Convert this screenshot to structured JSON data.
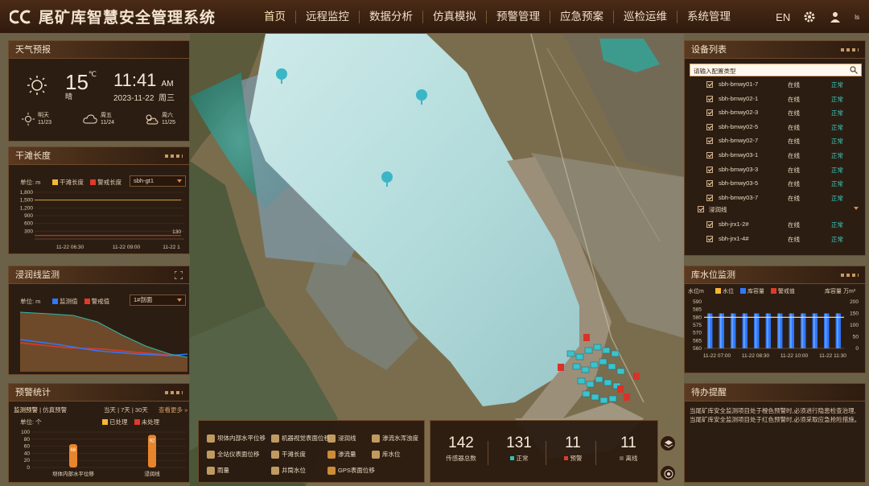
{
  "app": {
    "title": "尾矿库智慧安全管理系统"
  },
  "nav": {
    "items": [
      "首页",
      "远程监控",
      "数据分析",
      "仿真模拟",
      "预警管理",
      "应急预案",
      "巡检运维",
      "系统管理"
    ],
    "lang": "EN",
    "user_badge": "ls"
  },
  "weather": {
    "title": "天气预报",
    "temp": "15",
    "unit": "℃",
    "condition": "晴",
    "time": "11:41",
    "ampm": "AM",
    "date": "2023-11-22",
    "weekday": "周三",
    "forecast": [
      {
        "day": "明天",
        "date": "11/23",
        "icon": "sun-icon"
      },
      {
        "day": "周五",
        "date": "11/24",
        "icon": "cloud-icon"
      },
      {
        "day": "周六",
        "date": "11/25",
        "icon": "cloud-sun-icon"
      }
    ]
  },
  "beach": {
    "title": "干滩长度",
    "unit": "单位: m",
    "legend": [
      "干滩长度",
      "警戒长度"
    ],
    "select": "sbh-gt1",
    "ytick": [
      "1,800",
      "1,500",
      "1,200",
      "900",
      "600",
      "300"
    ],
    "xtick": [
      "11-22 06:30",
      "11-22 09:00",
      "11-22 1"
    ],
    "callout": "130",
    "chart_data": {
      "type": "line",
      "x": [
        "11-22 06:30",
        "11-22 09:00",
        "11-22 1"
      ],
      "series": [
        {
          "name": "干滩长度",
          "values": [
            130,
            130,
            130
          ]
        },
        {
          "name": "警戒长度",
          "values": [
            1500,
            1500,
            1500
          ]
        }
      ],
      "ylim": [
        0,
        1800
      ]
    }
  },
  "phreatic": {
    "title": "浸润线监测",
    "unit": "单位: m",
    "legend": [
      "监测值",
      "警戒值"
    ],
    "select": "1#剖面"
  },
  "alarm": {
    "title": "预警统计",
    "tabs": [
      "监测预警",
      "仿真预警"
    ],
    "range": [
      "当天",
      "7天",
      "30天"
    ],
    "more": "查看更多 »",
    "unit": "单位: 个",
    "legend": [
      "已处理",
      "未处理"
    ],
    "ytick": [
      "100",
      "80",
      "60",
      "40",
      "20",
      "0"
    ],
    "chart_data": {
      "type": "bar",
      "categories": [
        "坝体内部水平位移",
        "浸润线"
      ],
      "series": [
        {
          "name": "已处理",
          "values": [
            66,
            92
          ]
        }
      ],
      "ylim": [
        0,
        100
      ]
    }
  },
  "devices": {
    "title": "设备列表",
    "search_placeholder": "请输入配置类型",
    "group2": "浸润线",
    "rows": [
      {
        "name": "sbh-bmwy01-7",
        "status": "在线",
        "health": "正常"
      },
      {
        "name": "sbh-bmwy02-1",
        "status": "在线",
        "health": "正常"
      },
      {
        "name": "sbh-bmwy02-3",
        "status": "在线",
        "health": "正常"
      },
      {
        "name": "sbh-bmwy02-5",
        "status": "在线",
        "health": "正常"
      },
      {
        "name": "sbh-bmwy02-7",
        "status": "在线",
        "health": "正常"
      },
      {
        "name": "sbh-bmwy03-1",
        "status": "在线",
        "health": "正常"
      },
      {
        "name": "sbh-bmwy03-3",
        "status": "在线",
        "health": "正常"
      },
      {
        "name": "sbh-bmwy03-5",
        "status": "在线",
        "health": "正常"
      },
      {
        "name": "sbh-bmwy03-7",
        "status": "在线",
        "health": "正常"
      }
    ],
    "rows2": [
      {
        "name": "sbh-jrx1-2#",
        "status": "在线",
        "health": "正常"
      },
      {
        "name": "sbh-jrx1-4#",
        "status": "在线",
        "health": "正常"
      }
    ]
  },
  "water": {
    "title": "库水位监测",
    "left_unit": "水位m",
    "right_unit": "库容量 万m³",
    "legend": [
      "水位",
      "库容量",
      "警戒值"
    ],
    "yleft": [
      "590",
      "585",
      "580",
      "575",
      "570",
      "565",
      "560"
    ],
    "yright": [
      "200",
      "150",
      "100",
      "50",
      "0"
    ],
    "xtick": [
      "11-22 07:00",
      "11-22 08:30",
      "11-22 10:00",
      "11-22 11:30"
    ],
    "chart_data": {
      "type": "bar",
      "x": [
        "11-22 07:00",
        "11-22 08:30",
        "11-22 10:00",
        "11-22 11:30"
      ],
      "series": [
        {
          "name": "库容量",
          "values": [
            150,
            150,
            150,
            150,
            150,
            150,
            150,
            150,
            150,
            150,
            150,
            150
          ]
        },
        {
          "name": "警戒值",
          "values": [
            580,
            580,
            580,
            580,
            580,
            580,
            580,
            580,
            580,
            580,
            580,
            580
          ]
        }
      ],
      "ylim": [
        560,
        590
      ]
    }
  },
  "todo": {
    "title": "待办提醒",
    "text": "当尾矿库安全监测项目处于橙色预警时,必须进行隐患检查治理,当尾矿库安全监测项目处于红色预警时,必须采取应急抢险措施。"
  },
  "legend": {
    "items": [
      "坝体内部水平位移",
      "机器视觉表面位移",
      "浸润线",
      "渗流水浑浊度",
      "全站仪表面位移",
      "干滩长度",
      "渗流量",
      "库水位",
      "雨量",
      "井筒水位",
      "GPS表面位移"
    ]
  },
  "stats": [
    {
      "num": "142",
      "label": "传感器总数",
      "color": ""
    },
    {
      "num": "131",
      "label": "正常",
      "color": "#2fc2b8"
    },
    {
      "num": "11",
      "label": "预警",
      "color": "#e03a2a"
    },
    {
      "num": "11",
      "label": "离线",
      "color": "#6a5a4a"
    }
  ],
  "colors": {
    "accent": "#ffc24a",
    "danger": "#e03a2a",
    "ok": "#39d0c2",
    "blue": "#2f78ff"
  }
}
